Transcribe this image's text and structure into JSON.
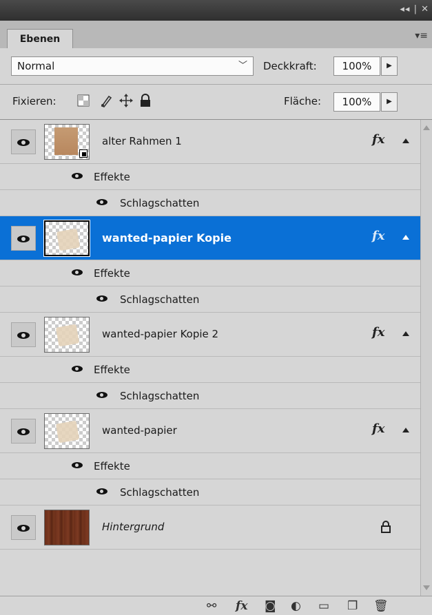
{
  "panel": {
    "tab_label": "Ebenen",
    "titlebar_controls": "◂◂ | ✕",
    "menu_icon": "panel-menu-icon"
  },
  "blend": {
    "mode": "Normal",
    "opacity_label": "Deckkraft:",
    "opacity_value": "100%",
    "lock_label": "Fixieren:",
    "fill_label": "Fläche:",
    "fill_value": "100%"
  },
  "layers": [
    {
      "name": "alter Rahmen 1",
      "fx": "fx",
      "effects_label": "Effekte",
      "effect": "Schlagschatten",
      "selected": false
    },
    {
      "name": "wanted-papier Kopie",
      "fx": "fx",
      "effects_label": "Effekte",
      "effect": "Schlagschatten",
      "selected": true
    },
    {
      "name": "wanted-papier Kopie 2",
      "fx": "fx",
      "effects_label": "Effekte",
      "effect": "Schlagschatten",
      "selected": false
    },
    {
      "name": "wanted-papier",
      "fx": "fx",
      "effects_label": "Effekte",
      "effect": "Schlagschatten",
      "selected": false
    },
    {
      "name": "Hintergrund",
      "locked": true,
      "selected": false
    }
  ],
  "footer": {
    "buttons": [
      "link-layers-icon",
      "add-style-icon",
      "add-mask-icon",
      "adjustment-layer-icon",
      "new-group-icon",
      "new-layer-icon",
      "delete-layer-icon"
    ],
    "fx_glyph": "fx"
  },
  "colors": {
    "selection": "#0a70d6",
    "panel_bg": "#d6d6d6"
  }
}
